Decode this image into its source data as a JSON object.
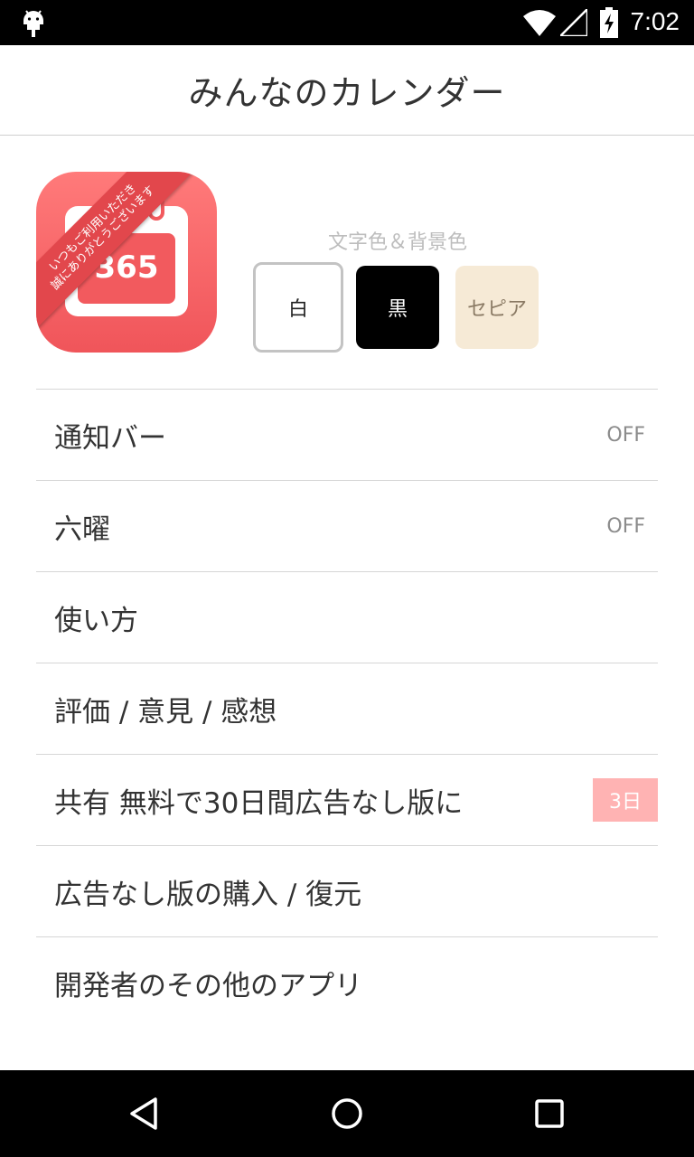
{
  "status_bar": {
    "time": "7:02",
    "icons": [
      "android-icon",
      "wifi-icon",
      "signal-icon",
      "battery-charging-icon"
    ]
  },
  "app_bar": {
    "title": "みんなのカレンダー"
  },
  "app_icon": {
    "ribbon_line1": "いつもご利用いただき",
    "ribbon_line2": "誠にありがとうございます",
    "number": "365",
    "bg_color": "#f25a5e"
  },
  "theme": {
    "label": "文字色＆背景色",
    "options": [
      {
        "label": "白",
        "selected": true
      },
      {
        "label": "黒",
        "selected": false
      },
      {
        "label": "セピア",
        "selected": false
      }
    ]
  },
  "menu": {
    "items": [
      {
        "label": "通知バー",
        "value": "OFF"
      },
      {
        "label": "六曜",
        "value": "OFF"
      },
      {
        "label": "使い方"
      },
      {
        "label": "評価 / 意見 / 感想"
      },
      {
        "label": "共有 無料で30日間広告なし版に",
        "badge": "3日"
      },
      {
        "label": "広告なし版の購入 / 復元"
      },
      {
        "label": "開発者のその他のアプリ"
      }
    ]
  },
  "nav_bar": {
    "icons": [
      "back-icon",
      "home-icon",
      "recents-icon"
    ]
  }
}
